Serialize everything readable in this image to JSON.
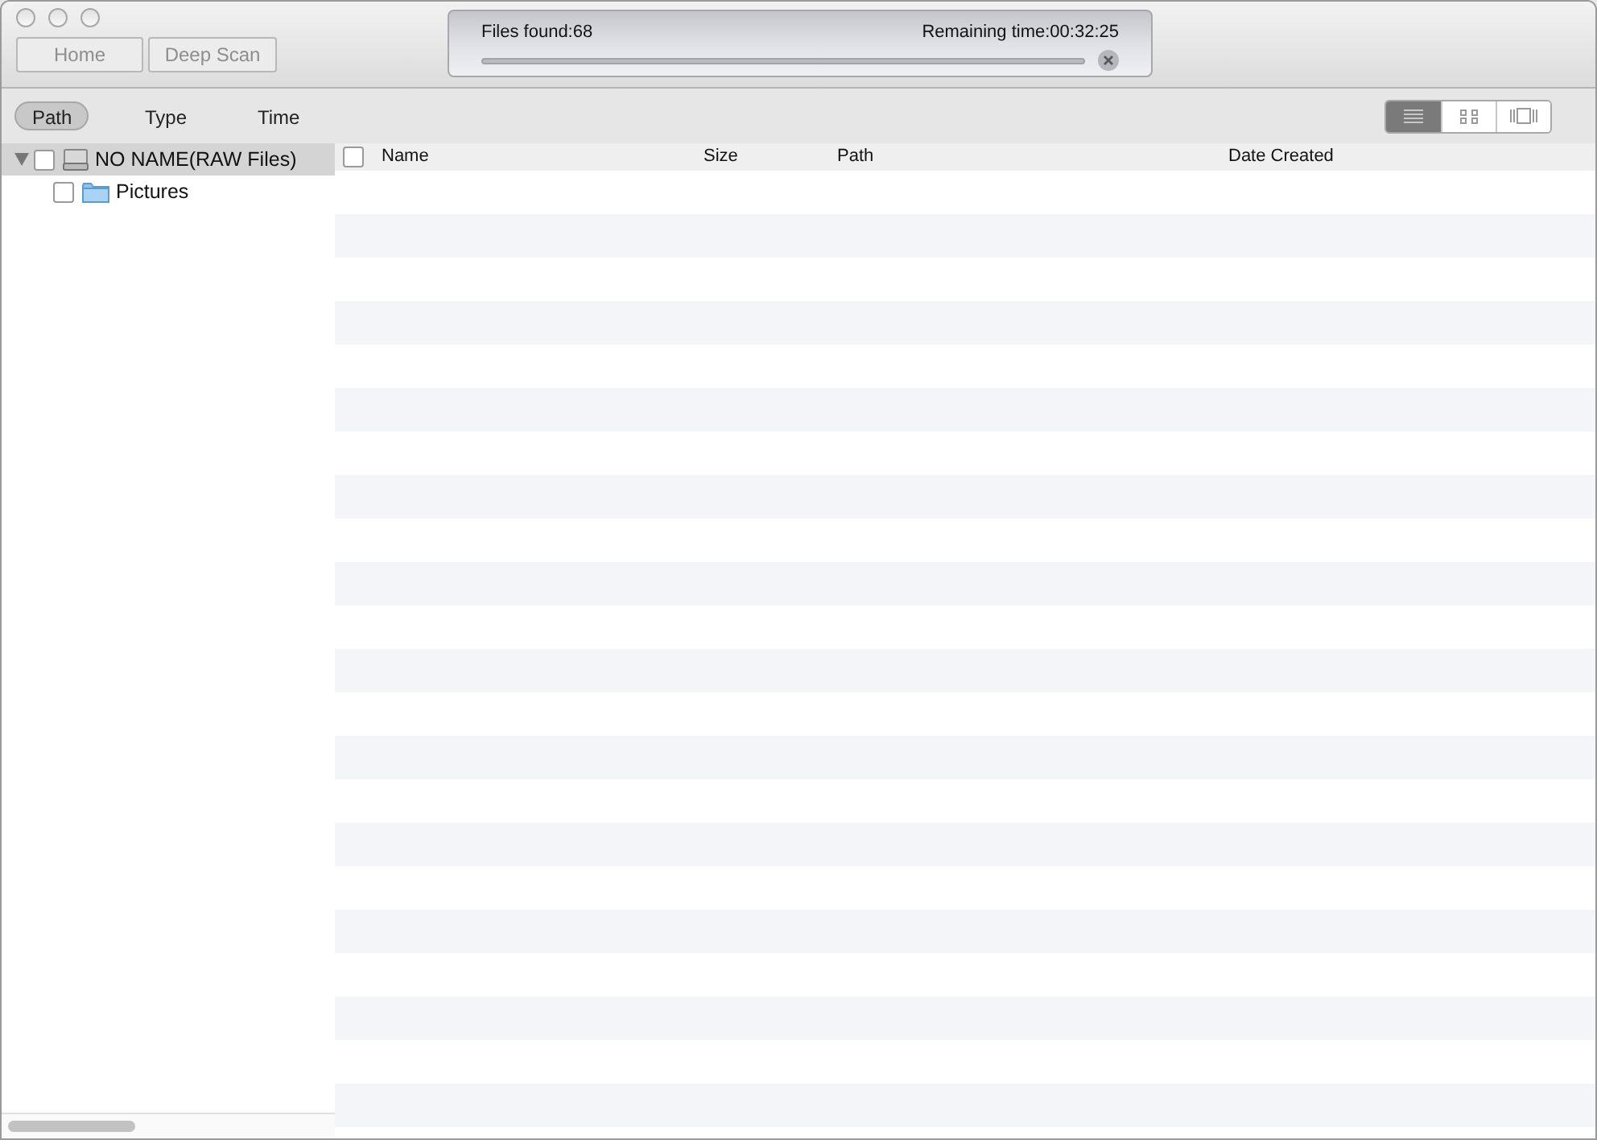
{
  "toolbar": {
    "buttons": [
      {
        "label": "Home",
        "disabled": true
      },
      {
        "label": "Deep Scan",
        "disabled": true
      }
    ]
  },
  "scan_status": {
    "files_found": "Files found:68",
    "remaining": "Remaining time:00:32:25",
    "level": 0
  },
  "filter_tabs": [
    {
      "label": "Path",
      "selected": true
    },
    {
      "label": "Type",
      "selected": false
    },
    {
      "label": "Time",
      "selected": false
    }
  ],
  "view_modes": [
    {
      "kind": "list",
      "selected": true
    },
    {
      "kind": "grid",
      "selected": false
    },
    {
      "kind": "coverflow",
      "selected": false
    }
  ],
  "tree": [
    {
      "label": "NO NAME(RAW Files)",
      "kind": "drive",
      "expanded": true,
      "checked": false,
      "selected": true,
      "children": [
        {
          "label": "Pictures",
          "kind": "folder",
          "checked": false,
          "selected": false
        }
      ]
    }
  ],
  "table": {
    "select_all_checked": false,
    "columns": [
      "Name",
      "Size",
      "Path",
      "Date Created"
    ]
  }
}
